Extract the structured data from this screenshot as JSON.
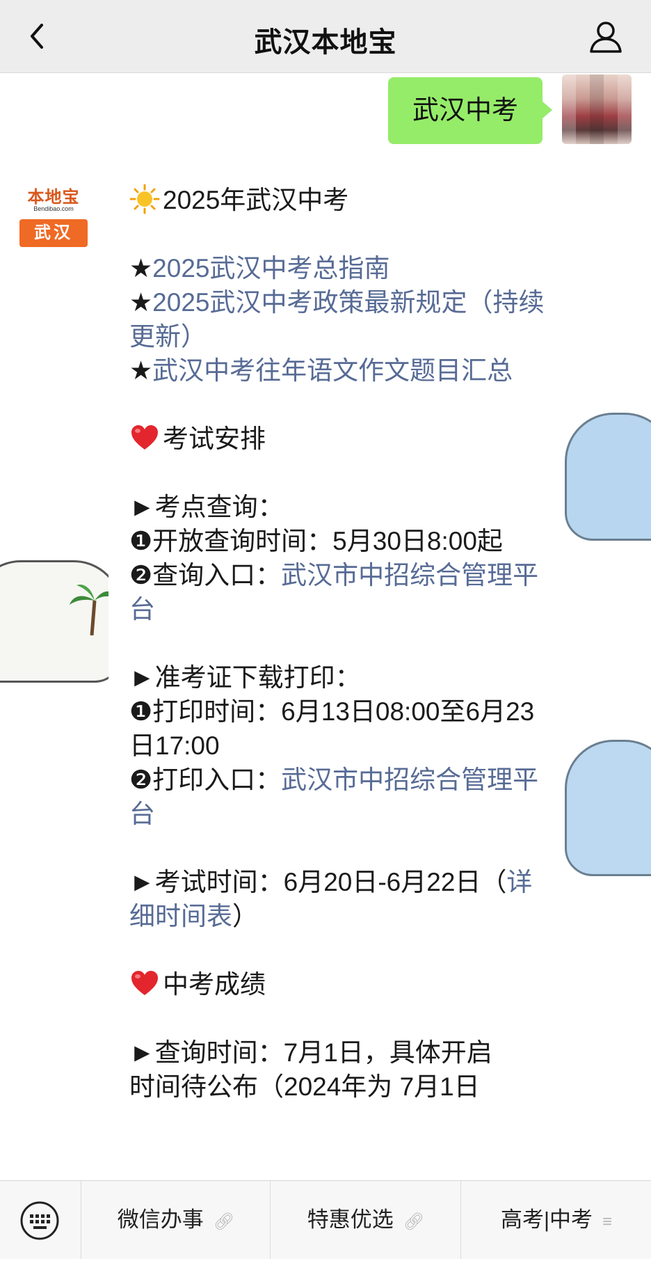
{
  "header": {
    "title": "武汉本地宝"
  },
  "user_message": {
    "text": "武汉中考"
  },
  "bot": {
    "logo_top": "本地宝",
    "logo_sub": "Bendibao.com",
    "logo_city": "武汉"
  },
  "message": {
    "heading": "2025年武汉中考",
    "links": [
      {
        "star": "★",
        "text": "2025武汉中考总指南"
      },
      {
        "star": "★",
        "text": "2025武汉中考政策最新规定（持续更新）"
      },
      {
        "star": "★",
        "text": "武汉中考往年语文作文题目汇总"
      }
    ],
    "section1_title": "考试安排",
    "kaodian": {
      "title": "►考点查询：",
      "item1": "❶开放查询时间：5月30日8:00起",
      "item2_prefix": "❷查询入口：",
      "item2_link": "武汉市中招综合管理平台"
    },
    "zhunkaozheng": {
      "title": "►准考证下载打印：",
      "item1": "❶打印时间：6月13日08:00至6月23日17:00",
      "item2_prefix": "❷打印入口：",
      "item2_link": "武汉市中招综合管理平台"
    },
    "exam_time": {
      "prefix": "►考试时间：6月20日-6月22日",
      "paren_open": "（",
      "link": "详细时间表",
      "paren_close": "）"
    },
    "section2_title": "中考成绩",
    "score": {
      "line1": "►查询时间：7月1日，具体开启",
      "line2_partial": "时间待公布（2024年为 7月1日"
    }
  },
  "menu": {
    "items": [
      {
        "label": "微信办事",
        "icon": "link-icon"
      },
      {
        "label": "特惠优选",
        "icon": "link-icon"
      },
      {
        "label": "高考|中考",
        "icon": "menu-lines-icon"
      }
    ]
  }
}
